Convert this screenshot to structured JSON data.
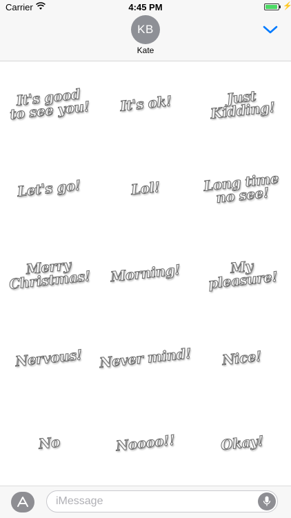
{
  "status_bar": {
    "carrier": "Carrier",
    "time": "4:45 PM",
    "battery_level": 0.95
  },
  "header": {
    "avatar_initials": "KB",
    "contact_name": "Kate"
  },
  "stickers": [
    {
      "text": "It's good\nto see you!"
    },
    {
      "text": "It's ok!"
    },
    {
      "text": "Just\nKidding!"
    },
    {
      "text": "Let's go!"
    },
    {
      "text": "Lol!"
    },
    {
      "text": "Long time\nno see!"
    },
    {
      "text": "Merry\nChristmas!"
    },
    {
      "text": "Morning!"
    },
    {
      "text": "My\npleasure!"
    },
    {
      "text": "Nervous!"
    },
    {
      "text": "Never mind!"
    },
    {
      "text": "Nice!"
    },
    {
      "text": "No"
    },
    {
      "text": "Noooo!!"
    },
    {
      "text": "Okay!"
    }
  ],
  "compose": {
    "placeholder": "iMessage"
  },
  "colors": {
    "accent": "#007aff",
    "avatar": "#8e9096",
    "battery": "#4cd964"
  }
}
